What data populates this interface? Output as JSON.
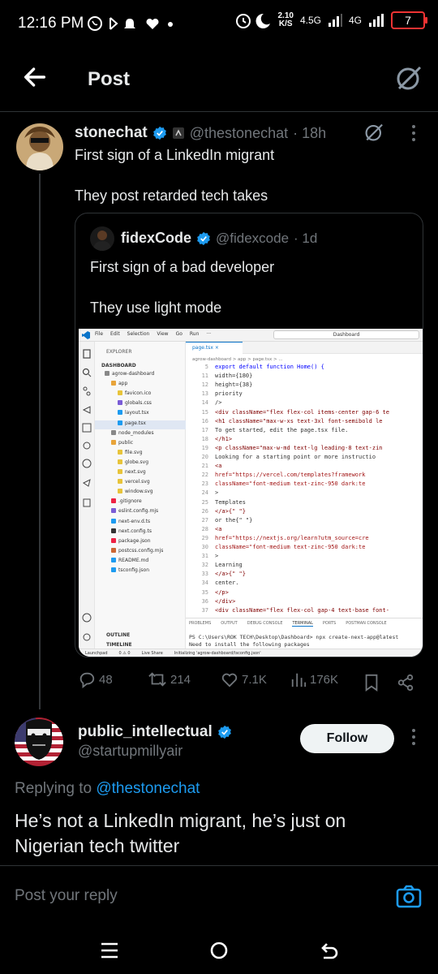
{
  "status_bar": {
    "time": "12:16 PM",
    "net_speed_value": "2.10",
    "net_speed_unit": "K/S",
    "net_type_1": "4.5G",
    "net_type_2": "4G",
    "battery": "7"
  },
  "header": {
    "title": "Post"
  },
  "main_post": {
    "author_name": "stonechat",
    "author_handle": "@thestonechat",
    "time": "· 18h",
    "text_line1": "First sign of a LinkedIn migrant",
    "text_line2": "They post retarded tech takes",
    "quote": {
      "author_name": "fidexCode",
      "author_handle": "@fidexcode",
      "time": "· 1d",
      "text_line1": "First sign of a bad developer",
      "text_line2": "They use light mode",
      "screenshot": {
        "menu": [
          "File",
          "Edit",
          "Selection",
          "View",
          "Go",
          "Run",
          "···"
        ],
        "search": "Dashboard",
        "explorer_label": "EXPLORER",
        "project": "DASHBOARD",
        "tree": [
          "agrow-dashboard",
          "app",
          "favicon.ico",
          "globals.css",
          "layout.tsx",
          "page.tsx",
          "node_modules",
          "public",
          "file.svg",
          "globe.svg",
          "next.svg",
          "vercel.svg",
          "window.svg",
          ".gitignore",
          "eslint.config.mjs",
          "next-env.d.ts",
          "next.config.ts",
          "package.json",
          "postcss.config.mjs",
          "README.md",
          "tsconfig.json"
        ],
        "outline": "OUTLINE",
        "timeline": "TIMELINE",
        "tab": "page.tsx",
        "breadcrumb": "agrow-dashboard > app > page.tsx > ...",
        "line_numbers": [
          "5",
          "11",
          "12",
          "13",
          "14",
          "15",
          "16",
          "17",
          "18",
          "19",
          "20",
          "21",
          "22",
          "23",
          "24",
          "25",
          "26",
          "27",
          "28",
          "29",
          "30",
          "31",
          "32",
          "33",
          "34",
          "35",
          "36",
          "37"
        ],
        "code": [
          "export default function Home() {",
          "      width={180}",
          "      height={38}",
          "      priority",
          "    />",
          "    <div className=\"flex flex-col items-center gap-6 te",
          "      <h1 className=\"max-w-xs text-3xl font-semibold le",
          "        To get started, edit the page.tsx file.",
          "      </h1>",
          "      <p className=\"max-w-md text-lg leading-8 text-zin",
          "        Looking for a starting point or more instructio",
          "        <a",
          "          href=\"https://vercel.com/templates?framework",
          "          className=\"font-medium text-zinc-950 dark:te",
          "        >",
          "          Templates",
          "        </a>{\" \"}",
          "        or the{\" \"}",
          "        <a",
          "          href=\"https://nextjs.org/learn?utm_source=cre",
          "          className=\"font-medium text-zinc-950 dark:te",
          "        >",
          "          Learning",
          "        </a>{\" \"}",
          "        center.",
          "      </p>",
          "    </div>",
          "    <div className=\"flex flex-col gap-4 text-base font-"
        ],
        "panel_tabs": [
          "PROBLEMS",
          "OUTPUT",
          "DEBUG CONSOLE",
          "TERMINAL",
          "PORTS",
          "POSTMAN CONSOLE"
        ],
        "terminal_line1": "PS C:\\Users\\ROK TECH\\Desktop\\Dashboard> npx create-next-app@latest",
        "terminal_line2": "Need to install the following packages",
        "statusbar": [
          "Launchpad",
          "0 ⚠ 0",
          "Live Share",
          "Initializing 'agrow-dashboard/tsconfig.json'"
        ]
      }
    },
    "stats": {
      "replies": "48",
      "reposts": "214",
      "likes": "7.1K",
      "views": "176K"
    }
  },
  "reply": {
    "author_name": "public_intellectual",
    "author_handle": "@startupmillyair",
    "follow_label": "Follow",
    "replying_prefix": "Replying to",
    "replying_handle": "@thestonechat",
    "text": "He’s not a LinkedIn migrant, he’s just on Nigerian tech twitter"
  },
  "compose": {
    "placeholder": "Post your reply"
  },
  "colors": {
    "accent": "#1d9bf0",
    "background": "#000000",
    "text": "#e7e9ea",
    "muted": "#71767b"
  },
  "icons": [
    "back-arrow-icon",
    "grok-icon",
    "verified-icon",
    "more-icon",
    "reply-icon",
    "repost-icon",
    "like-icon",
    "views-icon",
    "bookmark-icon",
    "share-icon",
    "camera-icon"
  ]
}
